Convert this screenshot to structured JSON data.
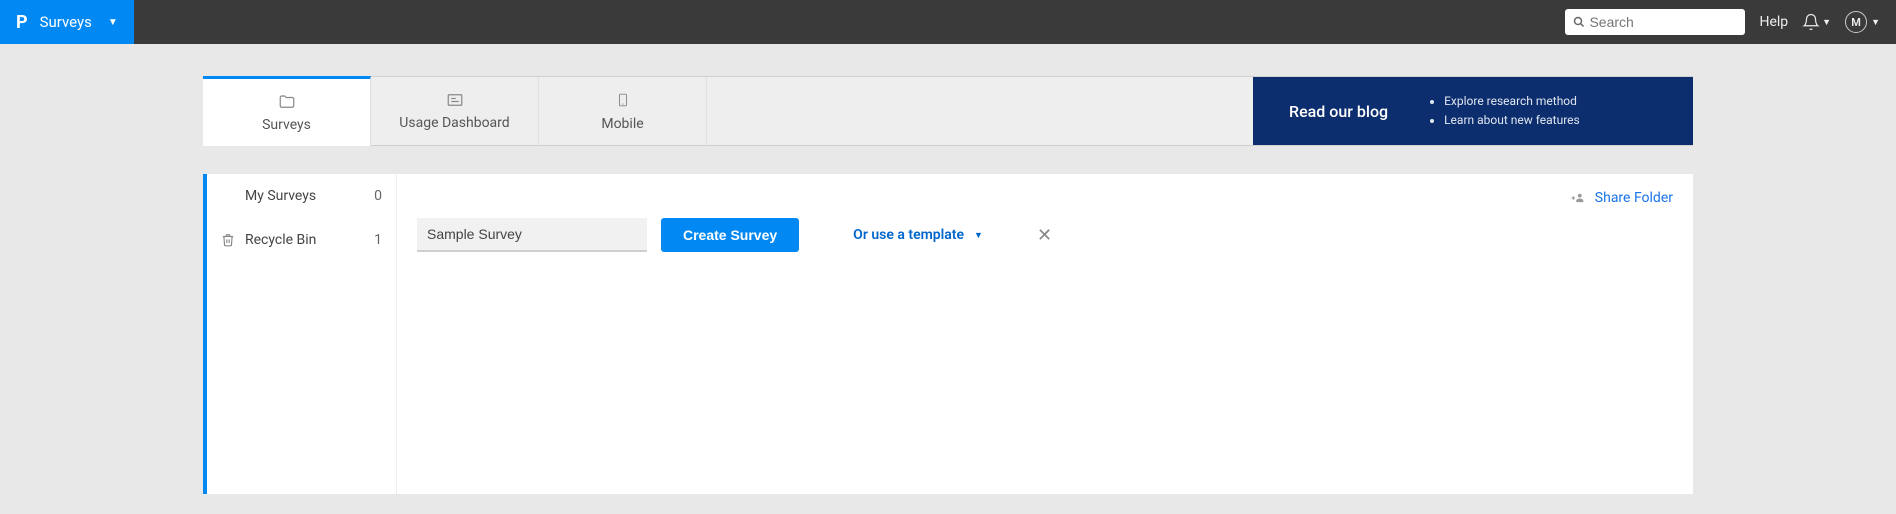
{
  "topbar": {
    "brand_letter": "P",
    "brand_label": "Surveys",
    "search_placeholder": "Search",
    "help_label": "Help",
    "avatar_letter": "M"
  },
  "tabs": {
    "surveys": "Surveys",
    "usage": "Usage Dashboard",
    "mobile": "Mobile"
  },
  "promo": {
    "title": "Read our blog",
    "item1": "Explore research method",
    "item2": "Learn about new features"
  },
  "sidebar": {
    "my_surveys_label": "My Surveys",
    "my_surveys_count": "0",
    "recycle_label": "Recycle Bin",
    "recycle_count": "1"
  },
  "main": {
    "share_folder_label": "Share Folder",
    "survey_name_value": "Sample Survey",
    "create_button_label": "Create Survey",
    "template_link_label": "Or use a template"
  }
}
